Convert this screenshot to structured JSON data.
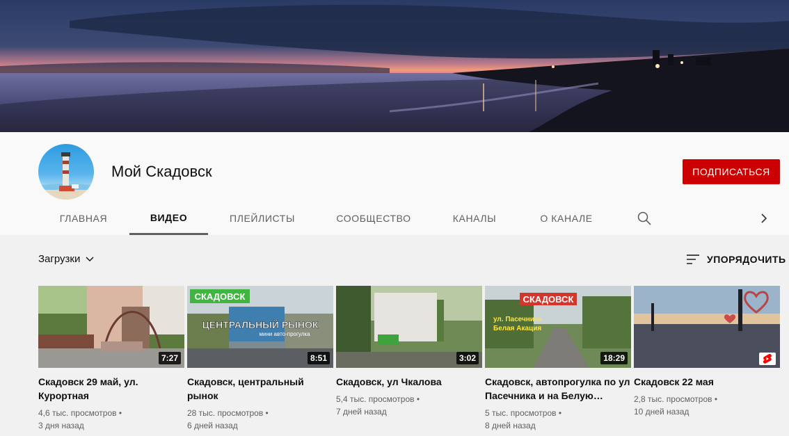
{
  "channel": {
    "name": "Мой Скадовск",
    "subscribe_label": "ПОДПИСАТЬСЯ",
    "accent": "#cc0000"
  },
  "tabs": [
    {
      "label": "ГЛАВНАЯ"
    },
    {
      "label": "ВИДЕО",
      "active": true
    },
    {
      "label": "ПЛЕЙЛИСТЫ"
    },
    {
      "label": "СООБЩЕСТВО"
    },
    {
      "label": "КАНАЛЫ"
    },
    {
      "label": "О КАНАЛЕ"
    }
  ],
  "toolbar": {
    "uploads_label": "Загрузки",
    "sort_label": "УПОРЯДОЧИТЬ"
  },
  "videos": [
    {
      "title": "Скадовск 29 май, ул. Курортная",
      "views": "4,6 тыс. просмотров",
      "age": "3 дня назад",
      "duration": "7:27"
    },
    {
      "title": "Скадовск, центральный рынок",
      "views": "28 тыс. просмотров",
      "age": "6 дней назад",
      "duration": "8:51",
      "overlay": {
        "tag": "СКАДОВСК",
        "caption": "ЦЕНТРАЛЬНЫЙ РЫНОК",
        "sub": "мини авто-прогулка"
      }
    },
    {
      "title": "Скадовск, ул Чкалова",
      "views": "5,4 тыс. просмотров",
      "age": "7 дней назад",
      "duration": "3:02"
    },
    {
      "title": "Скадовск, автопрогулка по ул Пасечника и на Белую…",
      "views": "5 тыс. просмотров",
      "age": "8 дней назад",
      "duration": "18:29",
      "overlay": {
        "tag": "СКАДОВСК",
        "line1": "ул. Пасечника",
        "line2": "Белая Акация"
      }
    },
    {
      "title": "Скадовск 22 мая",
      "views": "2,8 тыс. просмотров",
      "age": "10 дней назад",
      "badge": "shorts-icon"
    }
  ],
  "meta_separator": "•",
  "icons": {
    "search": "search-icon",
    "next": "chevron-right-icon",
    "dropdown": "chevron-down-icon",
    "sort": "sort-icon"
  }
}
